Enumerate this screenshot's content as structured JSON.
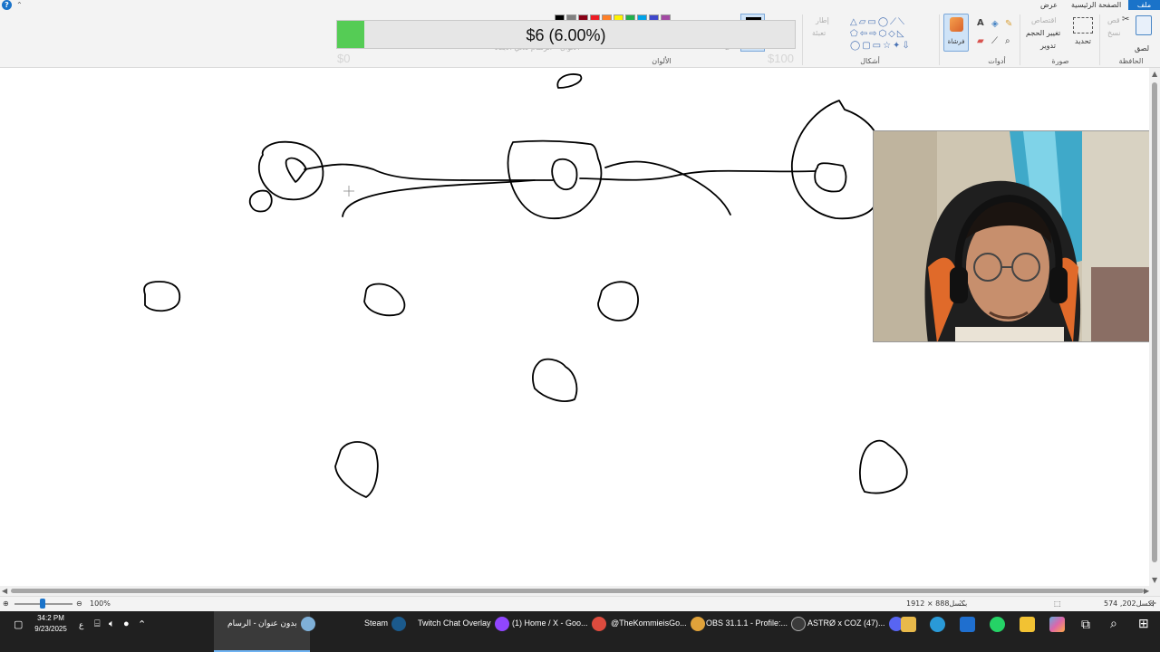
{
  "ribbon": {
    "tabs": {
      "file": "ملف",
      "home": "الصفحة الرئيسية",
      "view": "عرض"
    },
    "groups": {
      "clipboard": "الحافظة",
      "image": "صورة",
      "tools": "أدوات",
      "shapes": "أشكال",
      "colors": "الألوان"
    },
    "clipboard": {
      "paste": "لصق",
      "cut": "قص",
      "copy": "نسخ"
    },
    "image": {
      "select": "تحديد",
      "crop": "اقتصاص",
      "resize": "تغيير الحجم",
      "rotate": "تدوير"
    },
    "brushes": "فرشاة",
    "shapes": {
      "outline": "إطار",
      "fill": "تعبئة"
    },
    "size_label": "2",
    "colors_sub": "الألوان",
    "edit_colors": "الرسام ثلاثي الأبعاد",
    "palette": [
      "#000000",
      "#7f7f7f",
      "#880015",
      "#ed1c24",
      "#ff7f27",
      "#fff200",
      "#22b14c",
      "#00a2e8",
      "#3f48cc",
      "#a349a4"
    ],
    "accent": "#1a73c9"
  },
  "donation": {
    "text": "$6 (6.00%)",
    "percent": 6,
    "min": "$0",
    "max": "$100",
    "fill_color": "#55cc55"
  },
  "status": {
    "cursor_pos": "574 ,202بكسل",
    "canvas_size": "1912 × 888بكسل",
    "zoom": "100%"
  },
  "taskbar": {
    "time": "34:2 PM",
    "date": "9/23/2025",
    "lang": "ع",
    "items": [
      {
        "label": "بدون عنوان - الرسام",
        "icon": "paint-icon"
      },
      {
        "label": "Steam",
        "icon": "steam-icon"
      },
      {
        "label": "Twitch Chat Overlay",
        "icon": "twitch-icon"
      },
      {
        "label": "(1) Home / X - Goo...",
        "icon": "chrome-icon"
      },
      {
        "label": "@TheKommieisGo...",
        "icon": "chrome-icon"
      },
      {
        "label": "OBS 31.1.1 - Profile:...",
        "icon": "obs-icon"
      },
      {
        "label": "ASTRØ x COZ (47)...",
        "icon": "discord-icon"
      }
    ]
  }
}
